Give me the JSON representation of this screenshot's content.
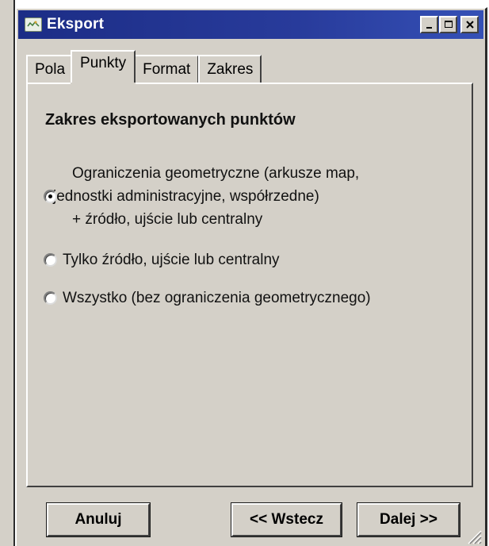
{
  "window": {
    "title": "Eksport"
  },
  "tabs": [
    {
      "label": "Pola",
      "active": false
    },
    {
      "label": "Punkty",
      "active": true
    },
    {
      "label": "Format",
      "active": false
    },
    {
      "label": "Zakres",
      "active": false
    }
  ],
  "panel": {
    "title": "Zakres eksportowanych punktów",
    "options": [
      {
        "lines": [
          "Ograniczenia geometryczne (arkusze map,",
          "jednostki administracyjne, współrzedne)",
          "+ źródło, ujście lub centralny"
        ],
        "selected": true
      },
      {
        "label": "Tylko źródło, ujście lub centralny",
        "selected": false
      },
      {
        "label": "Wszystko (bez ograniczenia geometrycznego)",
        "selected": false
      }
    ]
  },
  "buttons": {
    "cancel": "Anuluj",
    "back": "<< Wstecz",
    "next": "Dalej >>"
  },
  "colors": {
    "titlebar": "#1c2d86",
    "face": "#d4d0c8"
  }
}
